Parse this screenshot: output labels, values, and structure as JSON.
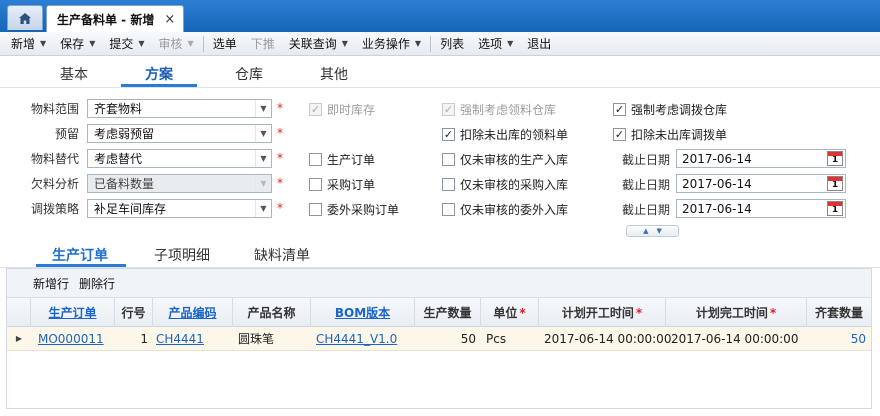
{
  "titlebar": {
    "home_icon": "home-icon",
    "doc_tab_title": "生产备料单 - 新增",
    "close_glyph": "×"
  },
  "toolbar": {
    "items": [
      {
        "label": "新增",
        "dropdown": true,
        "disabled": false
      },
      {
        "label": "保存",
        "dropdown": true,
        "disabled": false
      },
      {
        "label": "提交",
        "dropdown": true,
        "disabled": false
      },
      {
        "label": "审核",
        "dropdown": true,
        "disabled": true
      },
      {
        "label": "选单",
        "dropdown": false,
        "disabled": false
      },
      {
        "label": "下推",
        "dropdown": false,
        "disabled": true
      },
      {
        "label": "关联查询",
        "dropdown": true,
        "disabled": false
      },
      {
        "label": "业务操作",
        "dropdown": true,
        "disabled": false
      },
      {
        "label": "列表",
        "dropdown": false,
        "disabled": false
      },
      {
        "label": "选项",
        "dropdown": true,
        "disabled": false
      },
      {
        "label": "退出",
        "dropdown": false,
        "disabled": false
      }
    ]
  },
  "form_tabs": [
    "基本",
    "方案",
    "仓库",
    "其他"
  ],
  "form": {
    "fields": [
      {
        "label": "物料范围",
        "value": "齐套物料",
        "readonly": false
      },
      {
        "label": "预留",
        "value": "考虑弱预留",
        "readonly": false
      },
      {
        "label": "物料替代",
        "value": "考虑替代",
        "readonly": false
      },
      {
        "label": "欠料分析",
        "value": "已备料数量",
        "readonly": true
      },
      {
        "label": "调拨策略",
        "value": "补足车间库存",
        "readonly": false
      }
    ],
    "required_mark": "*",
    "col2": [
      {
        "label": "即时库存",
        "checked": true,
        "disabled": true
      },
      {
        "label": "生产订单",
        "checked": false,
        "disabled": false
      },
      {
        "label": "采购订单",
        "checked": false,
        "disabled": false
      },
      {
        "label": "委外采购订单",
        "checked": false,
        "disabled": false
      }
    ],
    "col3": [
      {
        "label": "强制考虑领料仓库",
        "checked": true,
        "disabled": true
      },
      {
        "label": "扣除未出库的领料单",
        "checked": true,
        "disabled": false
      },
      {
        "label": "仅未审核的生产入库",
        "checked": false,
        "disabled": false
      },
      {
        "label": "仅未审核的采购入库",
        "checked": false,
        "disabled": false
      },
      {
        "label": "仅未审核的委外入库",
        "checked": false,
        "disabled": false
      }
    ],
    "col4": [
      {
        "label": "强制考虑调拨仓库",
        "checked": true,
        "disabled": false
      },
      {
        "label": "扣除未出库调拨单",
        "checked": true,
        "disabled": false
      }
    ],
    "dates": [
      {
        "label": "截止日期",
        "value": "2017-06-14"
      },
      {
        "label": "截止日期",
        "value": "2017-06-14"
      },
      {
        "label": "截止日期",
        "value": "2017-06-14"
      }
    ],
    "calendar_day": "1",
    "check_glyph": "✓",
    "dropdown_glyph": "▼"
  },
  "sub_tabs": [
    "生产订单",
    "子项明细",
    "缺料清单"
  ],
  "grid": {
    "toolbar": [
      "新增行",
      "删除行"
    ],
    "columns": [
      {
        "label": "生产订单",
        "link": true,
        "required": false
      },
      {
        "label": "行号",
        "link": false,
        "required": false
      },
      {
        "label": "产品编码",
        "link": true,
        "required": false
      },
      {
        "label": "产品名称",
        "link": false,
        "required": false
      },
      {
        "label": "BOM版本",
        "link": true,
        "required": false
      },
      {
        "label": "生产数量",
        "link": false,
        "required": false
      },
      {
        "label": "单位",
        "link": false,
        "required": true
      },
      {
        "label": "计划开工时间",
        "link": false,
        "required": true
      },
      {
        "label": "计划完工时间",
        "link": false,
        "required": true
      },
      {
        "label": "齐套数量",
        "link": false,
        "required": false
      }
    ],
    "rows": [
      {
        "mo": "MO000011",
        "line": "1",
        "code": "CH4441",
        "name": "圆珠笔",
        "bom": "CH4441_V1.0",
        "qty": "50",
        "unit": "Pcs",
        "start": "2017-06-14 00:00:00",
        "end": "2017-06-14 00:00:00",
        "kit_qty": "50"
      }
    ],
    "row_indicator": "▶"
  }
}
